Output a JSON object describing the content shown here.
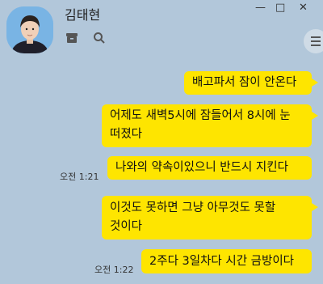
{
  "contact": {
    "name": "김태현"
  },
  "window_controls": {
    "minimize": "—",
    "maximize": "□",
    "close": "✕"
  },
  "toolbar": {
    "icons": [
      "archive-icon",
      "search-icon",
      "hamburger-menu-icon"
    ]
  },
  "messages": [
    {
      "text": "배고파서 잠이 안온다",
      "time": ""
    },
    {
      "line1": "어제도 새벽5시에 잠들어서 8시에 눈",
      "line2": "떠졌다",
      "time": ""
    },
    {
      "text": "나와의 약속이있으니 반드시 지킨다",
      "time": "오전 1:21"
    },
    {
      "line1": "이것도 못하면 그냥 아무것도 못할",
      "line2": "것이다",
      "time": ""
    },
    {
      "text": "2주다 3일차다 시간 금방이다",
      "time": "오전 1:22"
    }
  ],
  "colors": {
    "background": "#b2c7da",
    "bubble": "#fee500"
  }
}
